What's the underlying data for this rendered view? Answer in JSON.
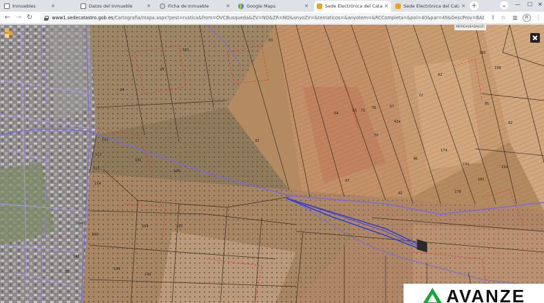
{
  "browser": {
    "tabs": [
      {
        "label": "Inmuebles",
        "icon": "document-icon"
      },
      {
        "label": "Datos del Inmueble",
        "icon": "document-icon"
      },
      {
        "label": "Ficha de Inmueble",
        "icon": "globe-icon"
      },
      {
        "label": "Google Maps",
        "icon": "google-maps-icon"
      },
      {
        "label": "Sede Electrónica del Catastro - F",
        "icon": "catastro-icon",
        "active": true
      },
      {
        "label": "Sede Electrónica del Catastro - C",
        "icon": "catastro-icon"
      }
    ],
    "url_host": "www1.sedecatastro.gob.es",
    "url_path": "/Cartografia/mapa.aspx?pest=rustica&from=OVCBusqueda&ZV=NO&ZR=NO&anyoZV=&tematicos=&anyotem=&RCCompleta=&pol=40&par=49&DescProv=BADAJOZ&prov=6&muni...",
    "avatar_initial": "R"
  },
  "map": {
    "coordinate_readout": "MERIDA(BADAJOZ)",
    "parcel_labels": [
      "161",
      "24",
      "29",
      "83",
      "111",
      "112",
      "113",
      "114",
      "141",
      "105",
      "47",
      "54",
      "55",
      "56",
      "57",
      "32",
      "42",
      "178",
      "181",
      "191",
      "192",
      "42a",
      "46",
      "94",
      "95",
      "100",
      "104",
      "107",
      "144",
      "145",
      "143",
      "71",
      "70",
      "81",
      "82",
      "62",
      "72",
      "174",
      "190",
      "198"
    ],
    "colors": {
      "parcel_line": "#3a2a1c",
      "boundary_blue": "#7a6bd9",
      "selected_parcel": "#2f3fd8",
      "cadastral_red": "#d9403b"
    }
  },
  "watermark": {
    "text": "AVANZE",
    "brand_color": "#18a53b"
  }
}
